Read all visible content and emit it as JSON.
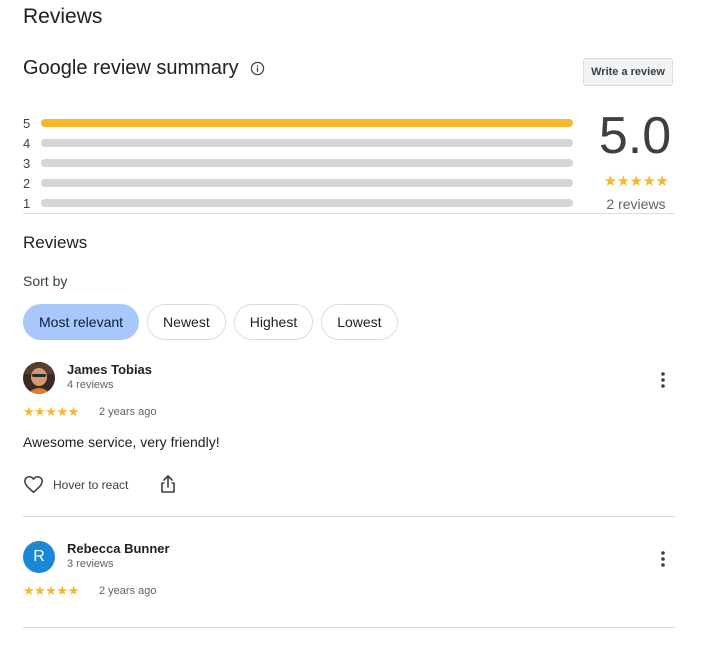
{
  "page": {
    "title": "Reviews"
  },
  "summary": {
    "title": "Google review summary",
    "write_button": "Write a review",
    "rating": "5.0",
    "stars": "★★★★★",
    "total": "2 reviews",
    "distribution": [
      {
        "stars": "5",
        "fraction": 1.0
      },
      {
        "stars": "4",
        "fraction": 0.0
      },
      {
        "stars": "3",
        "fraction": 0.0
      },
      {
        "stars": "2",
        "fraction": 0.0
      },
      {
        "stars": "1",
        "fraction": 0.0
      }
    ]
  },
  "reviews_section": {
    "title": "Reviews",
    "sort_label": "Sort by",
    "sort_options": [
      "Most relevant",
      "Newest",
      "Highest",
      "Lowest"
    ],
    "selected_sort": "Most relevant"
  },
  "reviews": [
    {
      "name": "James Tobias",
      "count": "4 reviews",
      "stars": "★★★★★",
      "rating": 5,
      "date": "2 years ago",
      "text": "Awesome service, very friendly!",
      "react_label": "Hover to react"
    },
    {
      "name": "Rebecca Bunner",
      "count": "3 reviews",
      "avatar_letter": "R",
      "stars": "★★★★★",
      "rating": 5,
      "date": "2 years ago"
    }
  ],
  "colors": {
    "star": "#f6b72c",
    "bar_track": "#d5d5d5",
    "chip_active": "#a8c7fa",
    "avatar_r": "#1a88d4"
  },
  "icons": [
    "info-icon",
    "more-vert-icon",
    "heart-icon",
    "share-icon"
  ]
}
